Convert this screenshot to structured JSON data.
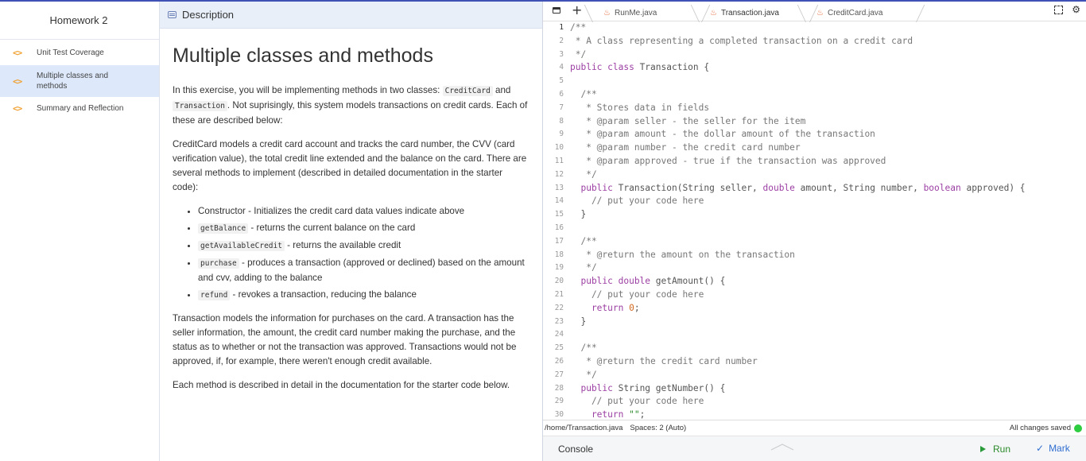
{
  "sidebar": {
    "title": "Homework 2",
    "items": [
      {
        "icon": "<>",
        "label": "Unit Test Coverage"
      },
      {
        "icon": "<>",
        "label": "Multiple classes and methods",
        "active": true
      },
      {
        "icon": "<>",
        "label": "Summary and Reflection"
      }
    ]
  },
  "description": {
    "header": "Description",
    "title": "Multiple classes and methods",
    "p1_a": "In this exercise, you will be implementing methods in two classes: ",
    "p1_code1": "CreditCard",
    "p1_b": " and ",
    "p1_code2": "Transaction",
    "p1_c": ". Not suprisingly, this system models transactions on credit cards. Each of these are described below:",
    "p2": "CreditCard models a credit card account and tracks the card number, the CVV (card verification value), the total credit line extended and the balance on the card. There are several methods to implement (described in detailed documentation in the starter code):",
    "list": [
      {
        "code": "",
        "text": "Constructor - Initializes the credit card data values indicate above"
      },
      {
        "code": "getBalance",
        "text": " - returns the current balance on the card"
      },
      {
        "code": "getAvailableCredit",
        "text": " - returns the available credit"
      },
      {
        "code": "purchase",
        "text": " - produces a transaction (approved or declined) based on the amount and cvv, adding to the balance"
      },
      {
        "code": "refund",
        "text": " - revokes a transaction, reducing the balance"
      }
    ],
    "p3": "Transaction models the information for purchases on the card. A transaction has the seller information, the amount, the credit card number making the purchase, and the status as to whether or not the transaction was approved. Transactions would not be approved, if, for example, there weren't enough credit available.",
    "p4": "Each method is described in detail in the documentation for the starter code below."
  },
  "editor": {
    "tabs": [
      {
        "icon": "java-icon",
        "label": "RunMe.java"
      },
      {
        "icon": "java-icon",
        "label": "Transaction.java",
        "active": true
      },
      {
        "icon": "java-icon",
        "label": "CreditCard.java"
      }
    ],
    "add_tab": "+",
    "lines": [
      {
        "n": "1",
        "t": [
          [
            "cm",
            "/**"
          ]
        ]
      },
      {
        "n": "2",
        "t": [
          [
            "cm",
            " * A class representing a completed transaction on a credit card"
          ]
        ]
      },
      {
        "n": "3",
        "t": [
          [
            "cm",
            " */"
          ]
        ]
      },
      {
        "n": "4",
        "t": [
          [
            "kw",
            "public class "
          ],
          [
            "src",
            "Transaction {"
          ]
        ]
      },
      {
        "n": "5",
        "t": []
      },
      {
        "n": "6",
        "t": [
          [
            "cm",
            "  /**"
          ]
        ]
      },
      {
        "n": "7",
        "t": [
          [
            "cm",
            "   * Stores data in fields"
          ]
        ]
      },
      {
        "n": "8",
        "t": [
          [
            "cm",
            "   * @param seller - the seller for the item"
          ]
        ]
      },
      {
        "n": "9",
        "t": [
          [
            "cm",
            "   * @param amount - the dollar amount of the transaction"
          ]
        ]
      },
      {
        "n": "10",
        "t": [
          [
            "cm",
            "   * @param number - the credit card number"
          ]
        ]
      },
      {
        "n": "11",
        "t": [
          [
            "cm",
            "   * @param approved - true if the transaction was approved"
          ]
        ]
      },
      {
        "n": "12",
        "t": [
          [
            "cm",
            "   */"
          ]
        ]
      },
      {
        "n": "13",
        "t": [
          [
            "kw",
            "  public "
          ],
          [
            "src",
            "Transaction(String seller, "
          ],
          [
            "kw",
            "double "
          ],
          [
            "src",
            "amount, String number, "
          ],
          [
            "kw",
            "boolean "
          ],
          [
            "src",
            "approved) {"
          ]
        ]
      },
      {
        "n": "14",
        "t": [
          [
            "cm",
            "    // put your code here"
          ]
        ]
      },
      {
        "n": "15",
        "t": [
          [
            "src",
            "  }"
          ]
        ]
      },
      {
        "n": "16",
        "t": []
      },
      {
        "n": "17",
        "t": [
          [
            "cm",
            "  /**"
          ]
        ]
      },
      {
        "n": "18",
        "t": [
          [
            "cm",
            "   * @return the amount on the transaction"
          ]
        ]
      },
      {
        "n": "19",
        "t": [
          [
            "cm",
            "   */"
          ]
        ]
      },
      {
        "n": "20",
        "t": [
          [
            "kw",
            "  public double "
          ],
          [
            "src",
            "getAmount() {"
          ]
        ]
      },
      {
        "n": "21",
        "t": [
          [
            "cm",
            "    // put your code here"
          ]
        ]
      },
      {
        "n": "22",
        "t": [
          [
            "kw",
            "    return "
          ],
          [
            "num",
            "0"
          ],
          [
            "src",
            ";"
          ]
        ]
      },
      {
        "n": "23",
        "t": [
          [
            "src",
            "  }"
          ]
        ]
      },
      {
        "n": "24",
        "t": []
      },
      {
        "n": "25",
        "t": [
          [
            "cm",
            "  /**"
          ]
        ]
      },
      {
        "n": "26",
        "t": [
          [
            "cm",
            "   * @return the credit card number"
          ]
        ]
      },
      {
        "n": "27",
        "t": [
          [
            "cm",
            "   */"
          ]
        ]
      },
      {
        "n": "28",
        "t": [
          [
            "kw",
            "  public "
          ],
          [
            "src",
            "String getNumber() {"
          ]
        ]
      },
      {
        "n": "29",
        "t": [
          [
            "cm",
            "    // put your code here"
          ]
        ]
      },
      {
        "n": "30",
        "t": [
          [
            "kw",
            "    return "
          ],
          [
            "str",
            "\"\""
          ],
          [
            "src",
            ";"
          ]
        ]
      }
    ],
    "status": {
      "path": "/home/Transaction.java",
      "spaces": "Spaces: 2 (Auto)",
      "saved": "All changes saved"
    },
    "console": {
      "label": "Console",
      "run": "Run",
      "mark": "Mark"
    }
  }
}
